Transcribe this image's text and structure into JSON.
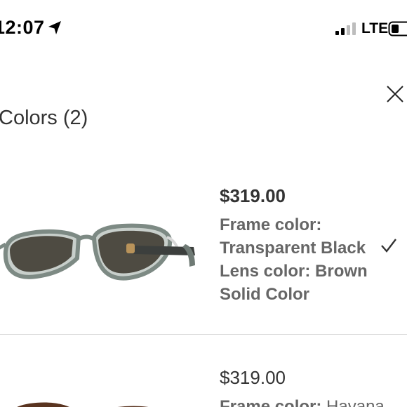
{
  "status_bar": {
    "time": "12:07",
    "network": "LTE",
    "icons": [
      "location-arrow-icon",
      "cellular-signal-icon",
      "battery-icon"
    ]
  },
  "header": {
    "title": "Colors (2)",
    "close_icon": "close-icon"
  },
  "products": [
    {
      "price": "$319.00",
      "frame_label": "Frame color:",
      "frame_value": "Transparent Black",
      "lens_label": "Lens color: Brown",
      "lens_value": "Solid Color",
      "selected": true,
      "frame_hex": "#7d8a84",
      "lens_hex": "#4e4b42"
    },
    {
      "price": "$319.00",
      "frame_label": "Frame color:",
      "frame_value": "Havana",
      "frame_hex": "#5a3420",
      "lens_hex": "#9a7a3a"
    }
  ],
  "colors": {
    "divider": "#d9d9d9",
    "text_primary": "#333333",
    "text_secondary": "#666666"
  }
}
